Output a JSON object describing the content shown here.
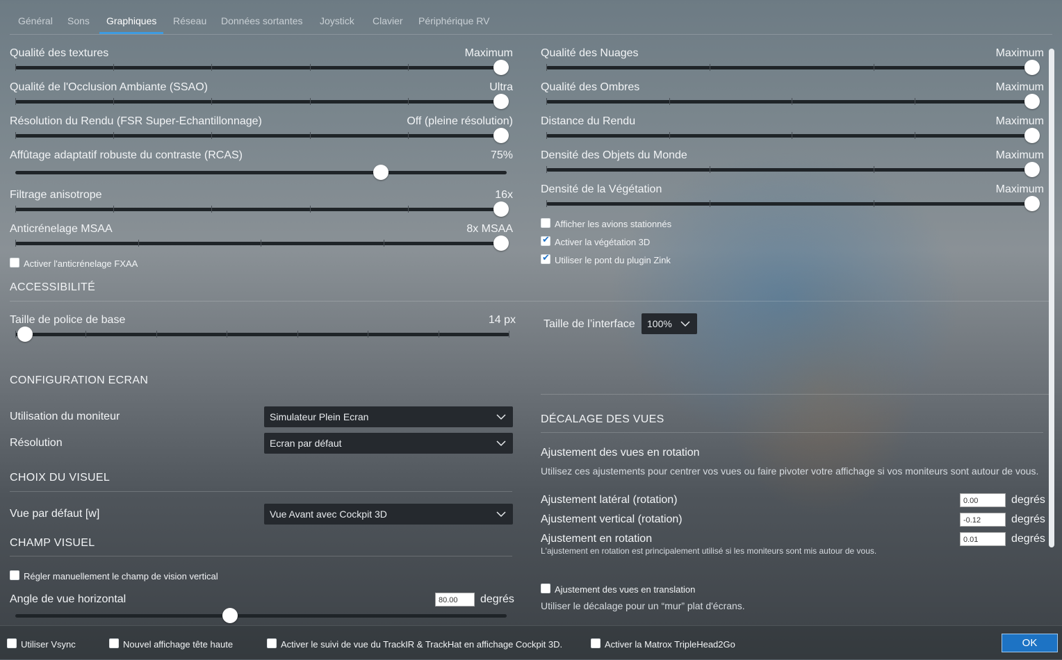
{
  "tabs": [
    "Général",
    "Sons",
    "Graphiques",
    "Réseau",
    "Données sortantes",
    "Joystick",
    "Clavier",
    "Périphérique  RV"
  ],
  "active_tab": "Graphiques",
  "left_sliders": [
    {
      "label": "Qualité des textures",
      "value": "Maximum",
      "fraction": 1.0
    },
    {
      "label": "Qualité de l'Occlusion Ambiante (SSAO)",
      "value": "Ultra",
      "fraction": 1.0
    },
    {
      "label": "Résolution du Rendu (FSR Super-Echantillonnage)",
      "value": "Off (pleine résolution)",
      "fraction": 1.0
    },
    {
      "label": "Affûtage adaptatif robuste du contraste (RCAS)",
      "value": "75%",
      "fraction": 0.75
    },
    {
      "label": "Filtrage anisotrope",
      "value": "16x",
      "fraction": 1.0
    },
    {
      "label": "Anticrénelage MSAA",
      "value": "8x MSAA",
      "fraction": 1.0
    }
  ],
  "fxaa_checkbox": {
    "label": "Activer l'anticrénelage FXAA",
    "checked": false
  },
  "right_sliders": [
    {
      "label": "Qualité des Nuages",
      "value": "Maximum",
      "fraction": 1.0
    },
    {
      "label": "Qualité des Ombres",
      "value": "Maximum",
      "fraction": 1.0
    },
    {
      "label": "Distance du Rendu",
      "value": "Maximum",
      "fraction": 1.0
    },
    {
      "label": "Densité des Objets du Monde",
      "value": "Maximum",
      "fraction": 1.0
    },
    {
      "label": "Densité de la Végétation",
      "value": "Maximum",
      "fraction": 1.0
    }
  ],
  "right_checkboxes": [
    {
      "label": "Afficher les avions stationnés",
      "checked": false
    },
    {
      "label": "Activer la végétation 3D",
      "checked": true
    },
    {
      "label": "Utiliser le pont du plugin Zink",
      "checked": true
    }
  ],
  "accessibility": {
    "title": "ACCESSIBILITÉ",
    "font_label": "Taille de police de base",
    "font_value": "14 px",
    "font_fraction": 0.0,
    "ui_scale_label": "Taille de l’interface",
    "ui_scale_value": "100%"
  },
  "screen_config": {
    "title": "CONFIGURATION ECRAN",
    "monitor_label": "Utilisation du moniteur",
    "monitor_value": "Simulateur Plein Ecran",
    "resolution_label": "Résolution",
    "resolution_value": "Ecran par défaut"
  },
  "visual_choice": {
    "title": "CHOIX DU VISUEL",
    "default_view_label": "Vue par défaut [w]",
    "default_view_value": "Vue Avant avec Cockpit 3D"
  },
  "field_of_view": {
    "title": "CHAMP VISUEL",
    "manual_label": "Régler manuellement le champ de vision vertical",
    "manual_checked": false,
    "angle_label": "Angle de vue horizontal",
    "angle_value": "80.00",
    "angle_unit": "degrés",
    "angle_fraction": 0.435
  },
  "view_offset": {
    "title": "DÉCALAGE DES VUES",
    "rotation_title": "Ajustement des vues en rotation",
    "rotation_desc": "Utilisez ces ajustements pour centrer vos vues ou faire pivoter votre affichage si vos moniteurs sont autour de vous.",
    "lateral_label": "Ajustement latéral (rotation)",
    "lateral_value": "0.00",
    "vertical_label": "Ajustement vertical (rotation)",
    "vertical_value": "-0.12",
    "roll_label": "Ajustement en rotation",
    "roll_value": "0.01",
    "unit": "degrés",
    "roll_note": "L'ajustement en rotation est principalement utilisé si les moniteurs sont mis autour de vous.",
    "translation_label": "Ajustement des vues en translation",
    "translation_checked": false,
    "translation_desc": "Utiliser le décalage pour un “mur” plat d'écrans."
  },
  "bottom": {
    "vsync": "Utiliser Vsync",
    "hud": "Nouvel affichage tête haute",
    "trackir": "Activer le suivi de vue du TrackIR & TrackHat en affichage Cockpit 3D.",
    "matrox": "Activer la Matrox TripleHead2Go",
    "ok": "OK"
  }
}
